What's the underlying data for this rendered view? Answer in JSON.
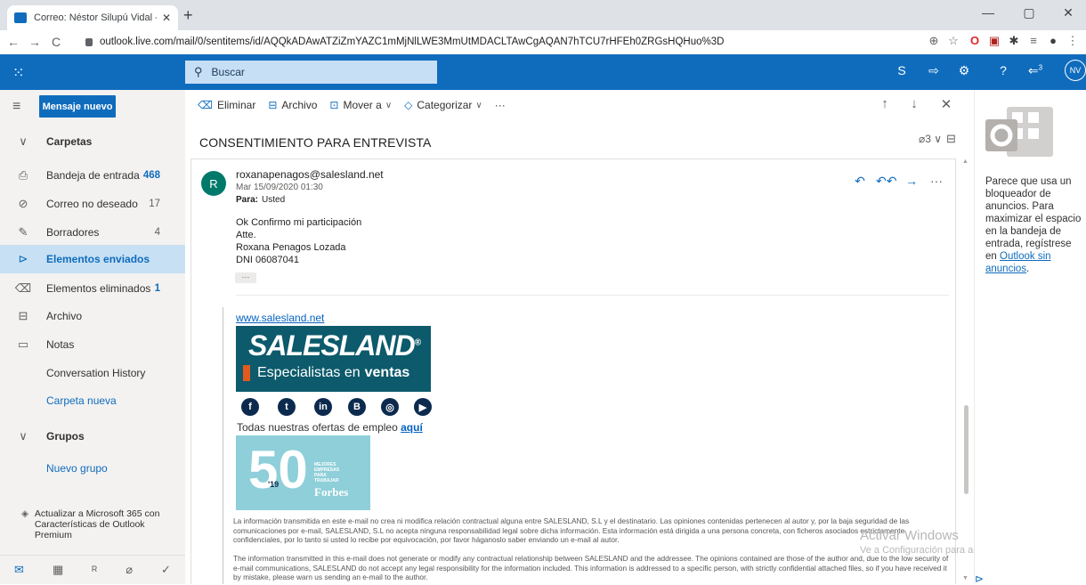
{
  "browser": {
    "tab_title": "Correo: Néstor Silupú Vidal - Out",
    "tab_close": "✕",
    "new_tab": "+",
    "url": "outlook.live.com/mail/0/sentitems/id/AQQkADAwATZiZmYAZC1mMjNlLWE3MmUtMDACLTAwCgAQAN7hTCU7rHFEh0ZRGsHQHuo%3D",
    "window_controls": [
      "—",
      "▢",
      "✕"
    ]
  },
  "topbar": {
    "search_placeholder": "Buscar",
    "avatar_initials": "NV",
    "notif_count": "3"
  },
  "left": {
    "new_message": "Mensaje nuevo",
    "folders_header": "Carpetas",
    "folders": [
      {
        "label": "Bandeja de entrada",
        "count": "468",
        "icon": "inbox-icon"
      },
      {
        "label": "Correo no deseado",
        "count": "17",
        "icon": "junk-icon"
      },
      {
        "label": "Borradores",
        "count": "4",
        "icon": "drafts-icon"
      },
      {
        "label": "Elementos enviados",
        "count": "",
        "icon": "sent-icon"
      },
      {
        "label": "Elementos eliminados",
        "count": "1",
        "icon": "deleted-icon"
      },
      {
        "label": "Archivo",
        "count": "",
        "icon": "archive-icon"
      },
      {
        "label": "Notas",
        "count": "",
        "icon": "notes-icon"
      },
      {
        "label": "Conversation History",
        "count": ""
      },
      {
        "label": "Carpeta nueva",
        "count": ""
      }
    ],
    "groups_header": "Grupos",
    "new_group": "Nuevo grupo",
    "upgrade_text": "Actualizar a Microsoft 365 con Características de Outlook Premium"
  },
  "commands": {
    "delete": "Eliminar",
    "archive": "Archivo",
    "move": "Mover a",
    "categorize": "Categorizar",
    "more": "···"
  },
  "message": {
    "subject": "CONSENTIMIENTO PARA ENTREVISTA",
    "thread_count": "3",
    "sender_initial": "R",
    "from": "roxanapenagos@salesland.net",
    "date": "Mar 15/09/2020 01:30",
    "to_label": "Para:",
    "to_value": "Usted",
    "body_lines": [
      "Ok Confirmo mi participación",
      "Atte.",
      "Roxana Penagos Lozada",
      "DNI 06087041"
    ],
    "expand_dots": "···",
    "signature": {
      "website": "www.salesland.net",
      "logo_text": "SALESLAND",
      "logo_reg": "®",
      "tagline_a": "Especialistas en",
      "tagline_b": "ventas",
      "social": [
        "f",
        "t",
        "in",
        "B",
        "◎",
        "▶"
      ],
      "offers_text": "Todas nuestras ofertas de empleo",
      "offers_link": "aquí",
      "badge_number": "50",
      "badge_year": "'19",
      "badge_small": "MEJORES EMPRESAS PARA TRABAJAR",
      "badge_brand": "Forbes"
    },
    "disclaimer_es": "La información transmitida en este e-mail no crea ni modifica relación contractual alguna entre SALESLAND, S.L y el destinatario. Las opiniones contenidas pertenecen al autor y, por la baja seguridad de las comunicaciones por e-mail, SALESLAND, S.L no acepta ninguna responsabilidad legal sobre dicha información. Esta información está dirigida a una persona concreta, con ficheros asociados estrictamente confidenciales, por lo tanto si usted lo recibe por equivocación, por favor háganoslo saber enviando un e-mail al autor.",
    "disclaimer_en": "The information transmitted in this e-mail does not generate or modify any contractual relationship between SALESLAND and the addressee. The opinions contained are those of the author and, due to the low security of e-mail communications, SALESLAND do not accept any legal responsibility for the information included. This information is addressed to a specific person, with strictly confidential attached files, so if you have received it by mistake, please warn us sending an e-mail to the author."
  },
  "watermark": {
    "line1": "Activar Windows",
    "line2": "Ve a Configuración para activar Windows."
  },
  "ad": {
    "text_before": "Parece que usa un bloqueador de anuncios. Para maximizar el espacio en la bandeja de entrada, regístrese en",
    "link": "Outlook sin anuncios",
    "text_after": "."
  }
}
